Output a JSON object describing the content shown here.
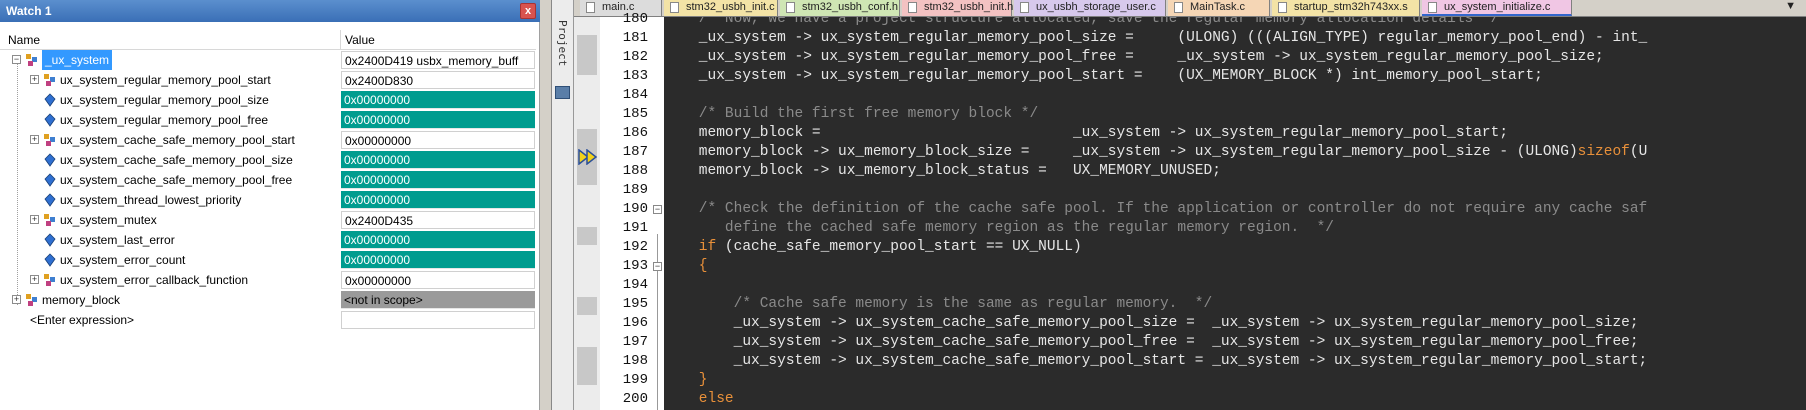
{
  "watch": {
    "title": "Watch 1",
    "close_label": "x",
    "header": {
      "name": "Name",
      "value": "Value"
    },
    "rows": [
      {
        "name": "_ux_system",
        "value": "0x2400D419 usbx_memory_buff",
        "style": "plain"
      },
      {
        "name": "ux_system_regular_memory_pool_start",
        "value": "0x2400D830",
        "style": "plain"
      },
      {
        "name": "ux_system_regular_memory_pool_size",
        "value": "0x00000000",
        "style": "teal"
      },
      {
        "name": "ux_system_regular_memory_pool_free",
        "value": "0x00000000",
        "style": "teal"
      },
      {
        "name": "ux_system_cache_safe_memory_pool_start",
        "value": "0x00000000",
        "style": "plain"
      },
      {
        "name": "ux_system_cache_safe_memory_pool_size",
        "value": "0x00000000",
        "style": "teal"
      },
      {
        "name": "ux_system_cache_safe_memory_pool_free",
        "value": "0x00000000",
        "style": "teal"
      },
      {
        "name": "ux_system_thread_lowest_priority",
        "value": "0x00000000",
        "style": "teal"
      },
      {
        "name": "ux_system_mutex",
        "value": "0x2400D435",
        "style": "plain"
      },
      {
        "name": "ux_system_last_error",
        "value": "0x00000000",
        "style": "teal"
      },
      {
        "name": "ux_system_error_count",
        "value": "0x00000000",
        "style": "teal"
      },
      {
        "name": "ux_system_error_callback_function",
        "value": "0x00000000",
        "style": "plain"
      },
      {
        "name": "memory_block",
        "value": "<not in scope>",
        "style": "grey"
      },
      {
        "name": "<Enter expression>",
        "value": "",
        "style": "empty"
      }
    ]
  },
  "project_tab": {
    "label": "Project"
  },
  "editor": {
    "tabs": [
      {
        "label": "main.c",
        "color": "#dcdcdc",
        "active": false
      },
      {
        "label": "stm32_usbh_init.c",
        "color": "#f3e3a6",
        "active": false
      },
      {
        "label": "stm32_usbh_conf.h",
        "color": "#cfe6b4",
        "active": false
      },
      {
        "label": "stm32_usbh_init.h",
        "color": "#f3c2c2",
        "active": false
      },
      {
        "label": "ux_usbh_storage_user.c",
        "color": "#d7c9ec",
        "active": false
      },
      {
        "label": "MainTask.c",
        "color": "#f5d6b5",
        "active": false
      },
      {
        "label": "startup_stm32h743xx.s",
        "color": "#f3e3a6",
        "active": false
      },
      {
        "label": "ux_system_initialize.c",
        "color": "#f0c6e4",
        "active": true
      }
    ],
    "tab_scroll": "▼",
    "line_numbers": [
      "180",
      "181",
      "182",
      "183",
      "184",
      "185",
      "186",
      "187",
      "188",
      "189",
      "190",
      "191",
      "192",
      "193",
      "194",
      "195",
      "196",
      "197",
      "198",
      "199",
      "200"
    ],
    "lines": [
      [
        [
          "cm",
          "    /* Now, we have a project structure allocated, save the regular memory allocation details */"
        ]
      ],
      [
        [
          "pl",
          "    _ux_system -> ux_system_regular_memory_pool_size =     (ULONG) (((ALIGN_TYPE) regular_memory_pool_end) - int_"
        ]
      ],
      [
        [
          "pl",
          "    _ux_system -> ux_system_regular_memory_pool_free =     _ux_system -> ux_system_regular_memory_pool_size;"
        ]
      ],
      [
        [
          "pl",
          "    _ux_system -> ux_system_regular_memory_pool_start =    (UX_MEMORY_BLOCK *) int_memory_pool_start;"
        ]
      ],
      [
        [
          "pl",
          ""
        ]
      ],
      [
        [
          "cm",
          "    /* Build the first free memory block */"
        ]
      ],
      [
        [
          "pl",
          "    memory_block =                             _ux_system -> ux_system_regular_memory_pool_start;"
        ]
      ],
      [
        [
          "pl",
          "    memory_block -> ux_memory_block_size =     _ux_system -> ux_system_regular_memory_pool_size - (ULONG)"
        ],
        [
          "fn",
          "sizeof"
        ],
        [
          "pl",
          "(U"
        ]
      ],
      [
        [
          "pl",
          "    memory_block -> ux_memory_block_status =   UX_MEMORY_UNUSED;"
        ]
      ],
      [
        [
          "pl",
          ""
        ]
      ],
      [
        [
          "cm",
          "    /* Check the definition of the cache safe pool. If the application or controller do not require any cache saf"
        ]
      ],
      [
        [
          "cm",
          "       define the cached safe memory region as the regular memory region.  */"
        ]
      ],
      [
        [
          "kw",
          "    if"
        ],
        [
          "pl",
          " (cache_safe_memory_pool_start == UX_NULL)"
        ]
      ],
      [
        [
          "kw",
          "    {"
        ]
      ],
      [
        [
          "pl",
          ""
        ]
      ],
      [
        [
          "cm",
          "        /* Cache safe memory is the same as regular memory.  */"
        ]
      ],
      [
        [
          "pl",
          "        _ux_system -> ux_system_cache_safe_memory_pool_size =  _ux_system -> ux_system_regular_memory_pool_size;"
        ]
      ],
      [
        [
          "pl",
          "        _ux_system -> ux_system_cache_safe_memory_pool_free =  _ux_system -> ux_system_regular_memory_pool_free;"
        ]
      ],
      [
        [
          "pl",
          "        _ux_system -> ux_system_cache_safe_memory_pool_start = _ux_system -> ux_system_regular_memory_pool_start;"
        ]
      ],
      [
        [
          "kw",
          "    }"
        ]
      ],
      [
        [
          "kw",
          "    else"
        ]
      ]
    ]
  },
  "colors": {
    "watch_changed": "#009c8f",
    "editor_bg": "#2b2b2b",
    "keyword": "#e8903a",
    "comment": "#8a8a8a",
    "selection": "#3399ff"
  }
}
